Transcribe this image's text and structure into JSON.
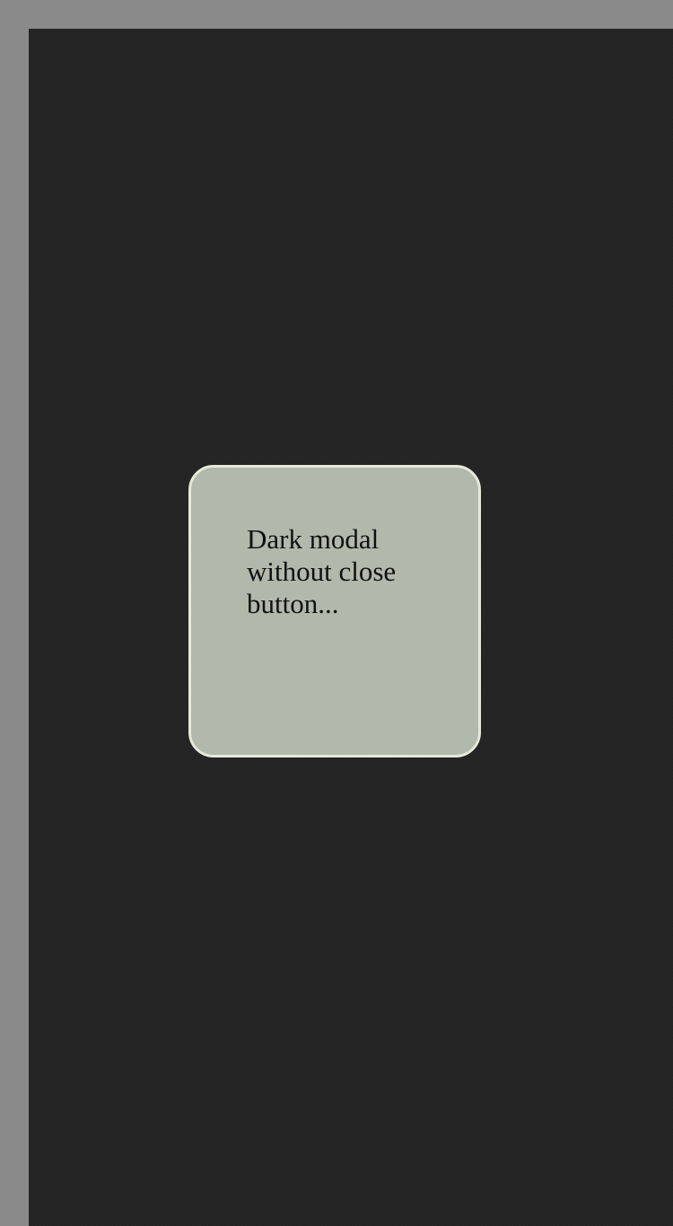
{
  "overlay": {
    "background_color": "#242424",
    "page_border_color": "#8a8a8a"
  },
  "modal": {
    "message": "Dark modal without close button...",
    "background_color": "#b2b8ac",
    "border_color": "#e6e8d9"
  }
}
